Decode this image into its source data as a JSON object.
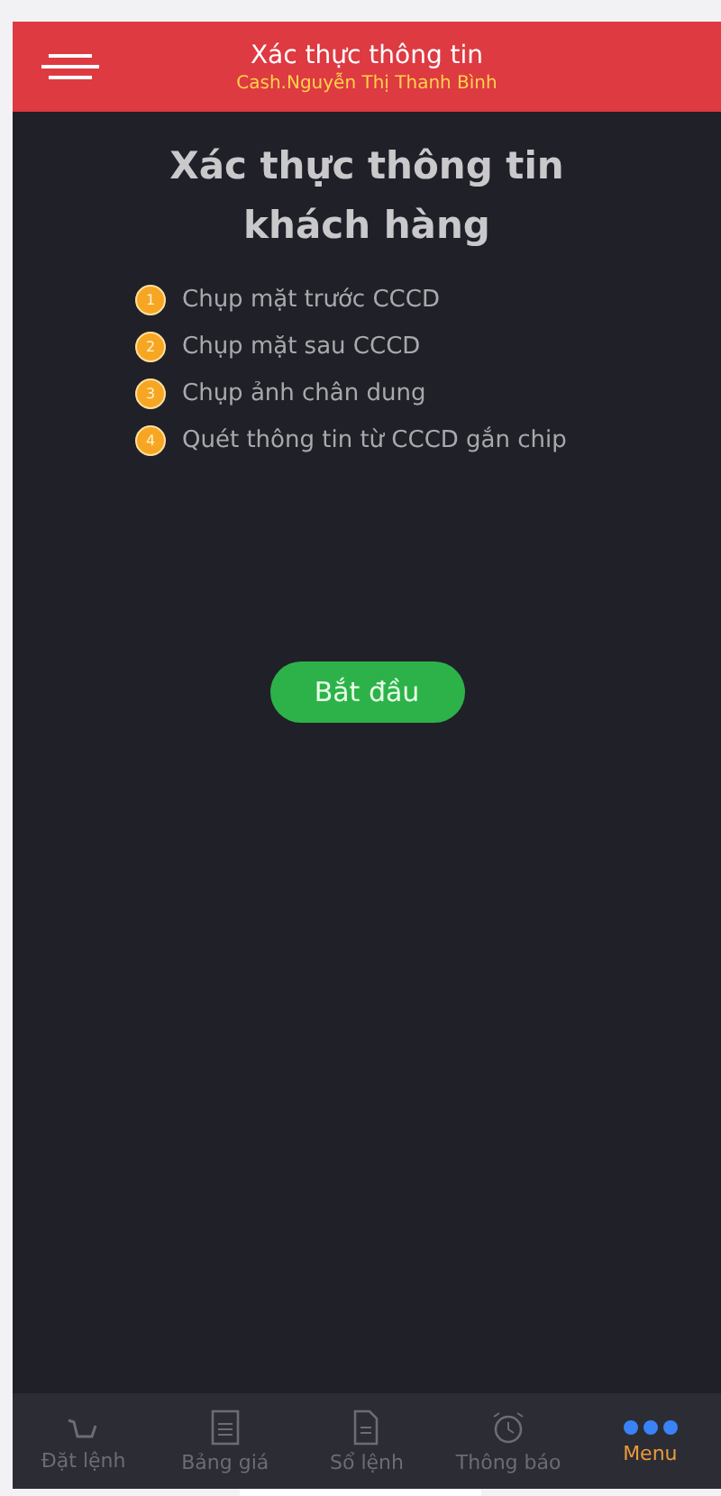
{
  "header": {
    "title": "Xác thực thông tin",
    "subtitle": "Cash.Nguyễn Thị Thanh Bình"
  },
  "heading": "Xác thực thông tin khách hàng",
  "steps": [
    {
      "number": "1",
      "label": "Chụp mặt trước CCCD"
    },
    {
      "number": "2",
      "label": "Chụp mặt sau CCCD"
    },
    {
      "number": "3",
      "label": "Chụp ảnh chân dung"
    },
    {
      "number": "4",
      "label": "Quét thông tin từ CCCD gắn chip"
    }
  ],
  "start_button": "Bắt đầu",
  "tabs": [
    {
      "kind": "cart",
      "label": "Đặt lệnh",
      "selected": false
    },
    {
      "kind": "board",
      "label": "Bảng giá",
      "selected": false
    },
    {
      "kind": "doc",
      "label": "Sổ lệnh",
      "selected": false
    },
    {
      "kind": "alarm",
      "label": "Thông báo",
      "selected": false
    },
    {
      "kind": "dots",
      "label": "Menu",
      "selected": true
    }
  ]
}
